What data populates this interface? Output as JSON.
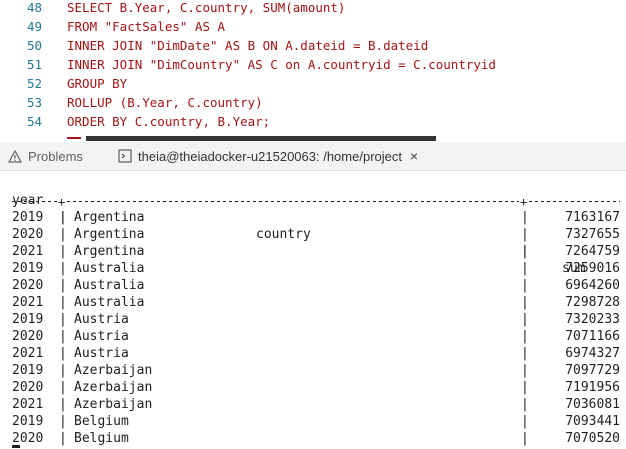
{
  "editor": {
    "lines": [
      {
        "num": "48",
        "code": "SELECT B.Year, C.country, SUM(amount)"
      },
      {
        "num": "49",
        "code": "FROM \"FactSales\" AS A"
      },
      {
        "num": "50",
        "code": "INNER JOIN \"DimDate\" AS B ON A.dateid = B.dateid"
      },
      {
        "num": "51",
        "code": "INNER JOIN \"DimCountry\" AS C on A.countryid = C.countryid"
      },
      {
        "num": "52",
        "code": "GROUP BY"
      },
      {
        "num": "53",
        "code": "ROLLUP (B.Year, C.country)"
      },
      {
        "num": "54",
        "code": "ORDER BY C.country, B.Year;"
      }
    ]
  },
  "panel": {
    "problems_tab": "Problems",
    "terminal_tab": "theia@theiadocker-u21520063: /home/project",
    "close_glyph": "×"
  },
  "result": {
    "headers": {
      "year": "year",
      "country": "country",
      "sum": "sum"
    },
    "separator": "|",
    "rows": [
      {
        "year": "2019",
        "country": "Argentina",
        "sum": "7163167"
      },
      {
        "year": "2020",
        "country": "Argentina",
        "sum": "7327655"
      },
      {
        "year": "2021",
        "country": "Argentina",
        "sum": "7264759"
      },
      {
        "year": "2019",
        "country": "Australia",
        "sum": "7259016"
      },
      {
        "year": "2020",
        "country": "Australia",
        "sum": "6964260"
      },
      {
        "year": "2021",
        "country": "Australia",
        "sum": "7298728"
      },
      {
        "year": "2019",
        "country": "Austria",
        "sum": "7320233"
      },
      {
        "year": "2020",
        "country": "Austria",
        "sum": "7071166"
      },
      {
        "year": "2021",
        "country": "Austria",
        "sum": "6974327"
      },
      {
        "year": "2019",
        "country": "Azerbaijan",
        "sum": "7097729"
      },
      {
        "year": "2020",
        "country": "Azerbaijan",
        "sum": "7191956"
      },
      {
        "year": "2021",
        "country": "Azerbaijan",
        "sum": "7036081"
      },
      {
        "year": "2019",
        "country": "Belgium",
        "sum": "7093441"
      },
      {
        "year": "2020",
        "country": "Belgium",
        "sum": "7070520"
      }
    ]
  },
  "colors": {
    "line_number": "#237893",
    "sql_text": "#a31515",
    "terminal_text": "#1f1f1f",
    "tabbar_bg": "#f3f3f3"
  },
  "icons": {
    "problems": "warning-icon",
    "terminal": "terminal-icon",
    "close": "close-icon"
  }
}
